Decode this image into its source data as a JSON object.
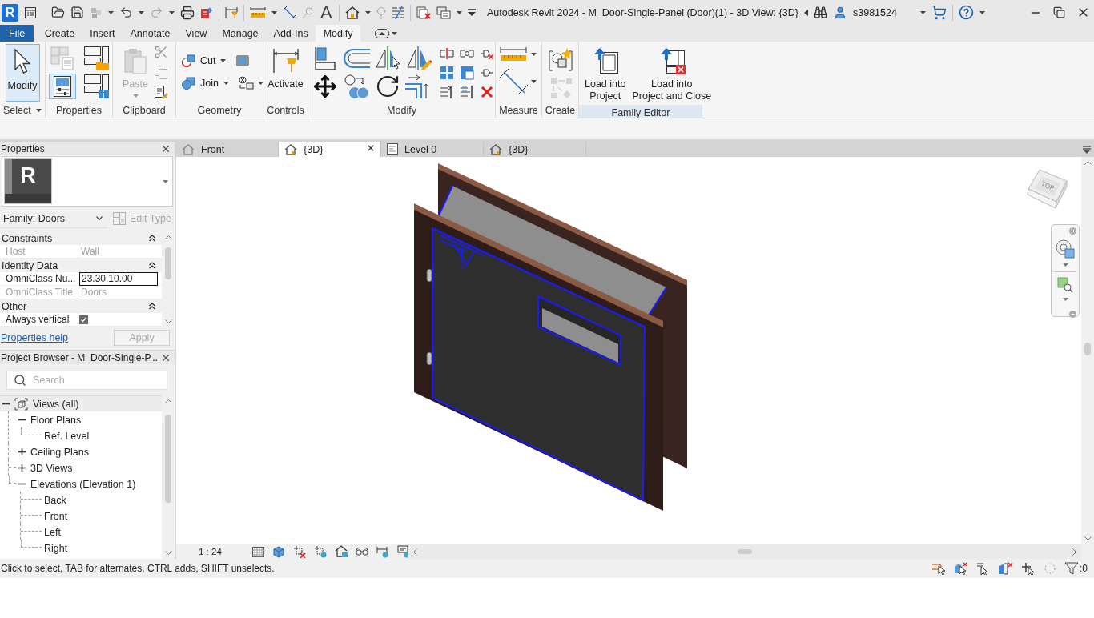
{
  "app_button": {
    "letter": "R"
  },
  "quick_access": {
    "text_tool": "A"
  },
  "title": "Autodesk Revit 2024 - M_Door-Single-Panel (Door)(1) - 3D View: {3D}",
  "user": {
    "name": "s3981524"
  },
  "ribbon_tabs": [
    {
      "label": "File",
      "kind": "file",
      "selected": false
    },
    {
      "label": "Create",
      "kind": "tab",
      "selected": false
    },
    {
      "label": "Insert",
      "kind": "tab",
      "selected": false
    },
    {
      "label": "Annotate",
      "kind": "tab",
      "selected": false
    },
    {
      "label": "View",
      "kind": "tab",
      "selected": false
    },
    {
      "label": "Manage",
      "kind": "tab",
      "selected": false
    },
    {
      "label": "Add-Ins",
      "kind": "tab",
      "selected": false
    },
    {
      "label": "Modify",
      "kind": "tab",
      "selected": true
    }
  ],
  "ribbon": {
    "select": {
      "label": "Select",
      "tool": {
        "label": "Modify",
        "selected": true
      }
    },
    "properties": {
      "label": "Properties",
      "palette_on": true
    },
    "clipboard": {
      "label": "Clipboard",
      "paste": {
        "label": "Paste",
        "disabled": true
      }
    },
    "geometry": {
      "label": "Geometry",
      "cut": "Cut",
      "join": "Join"
    },
    "controls": {
      "label": "Controls",
      "activate": "Activate"
    },
    "modify": {
      "label": "Modify"
    },
    "measure": {
      "label": "Measure"
    },
    "create": {
      "label": "Create"
    },
    "family_editor": {
      "label": "Family Editor",
      "load": "Load into\nProject",
      "load_close": "Load into\nProject and Close"
    }
  },
  "properties": {
    "title": "Properties",
    "type_image_letter": "R",
    "family_selector": "Family: Doors",
    "edit_type": {
      "label": "Edit Type",
      "disabled": true
    },
    "groups": [
      {
        "name": "Constraints",
        "expanded": true,
        "rows": [
          {
            "label": "Host",
            "kind": "text",
            "value": "Wall",
            "disabled": true
          }
        ]
      },
      {
        "name": "Identity Data",
        "expanded": true,
        "rows": [
          {
            "label": "OmniClass Nu...",
            "kind": "field",
            "value": "23.30.10.00",
            "disabled": false
          },
          {
            "label": "OmniClass Title",
            "kind": "text",
            "value": "Doors",
            "disabled": true
          }
        ]
      },
      {
        "name": "Other",
        "expanded": true,
        "rows": [
          {
            "label": "Always vertical",
            "kind": "checkbox",
            "checked": true,
            "disabled": false
          }
        ]
      }
    ],
    "help_link": "Properties help",
    "apply": {
      "label": "Apply",
      "disabled": true
    }
  },
  "project_browser": {
    "title": "Project Browser - M_Door-Single-P...",
    "search": {
      "placeholder": "Search"
    },
    "tree": [
      {
        "label": "Views (all)",
        "expanded": true,
        "selected": true,
        "children": [
          {
            "label": "Floor Plans",
            "expanded": true,
            "selected": false,
            "children": [
              {
                "label": "Ref. Level",
                "selected": false
              }
            ]
          },
          {
            "label": "Ceiling Plans",
            "expanded": false,
            "selected": false
          },
          {
            "label": "3D Views",
            "expanded": false,
            "selected": false
          },
          {
            "label": "Elevations (Elevation 1)",
            "expanded": true,
            "selected": false,
            "children": [
              {
                "label": "Back",
                "selected": false
              },
              {
                "label": "Front",
                "selected": false
              },
              {
                "label": "Left",
                "selected": false
              },
              {
                "label": "Right",
                "selected": false
              }
            ]
          }
        ]
      }
    ]
  },
  "view_tabs": [
    {
      "label": "Front",
      "kind": "elevation",
      "selected": false
    },
    {
      "label": "{3D}",
      "kind": "model",
      "selected": true
    },
    {
      "label": "Level 0",
      "kind": "plan",
      "selected": false
    },
    {
      "label": "{3D}",
      "kind": "model",
      "selected": false
    }
  ],
  "view_cube": {
    "face": "TOP"
  },
  "view_control_bar": {
    "scale": "1 : 24"
  },
  "status_bar": {
    "text": "Click to select, TAB for alternates, CTRL adds, SHIFT unselects.",
    "filter_count": ":0"
  }
}
